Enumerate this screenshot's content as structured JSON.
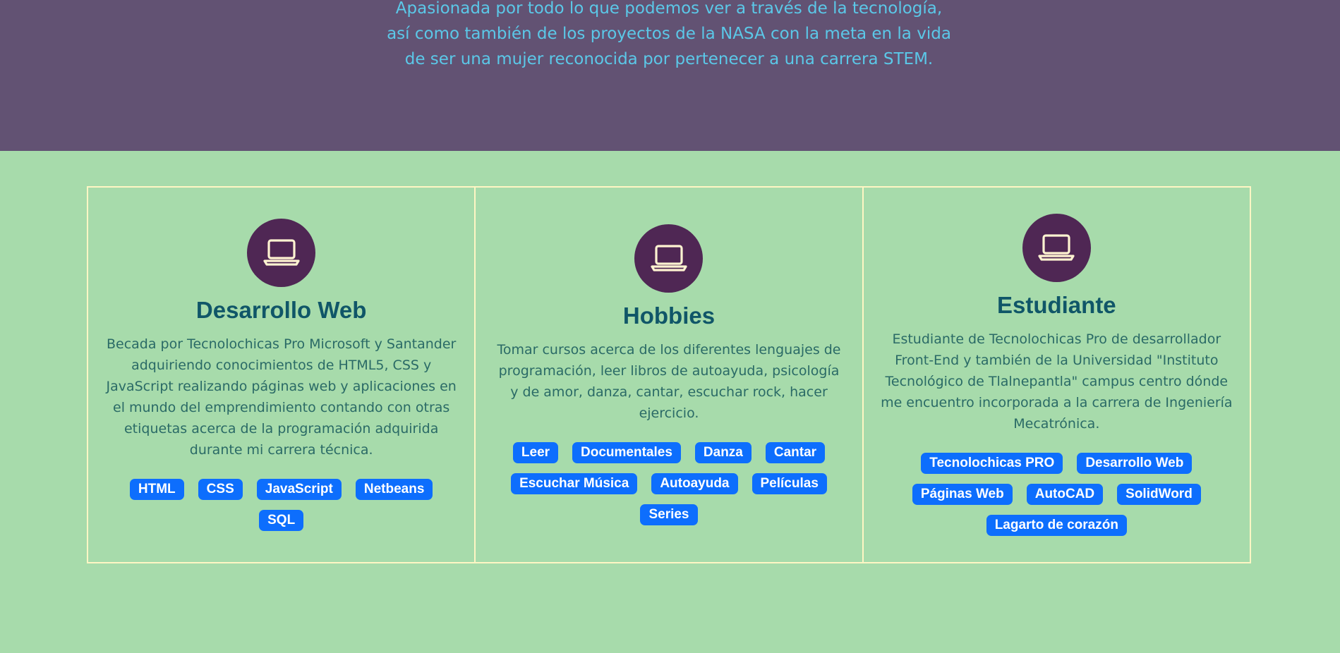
{
  "hero": {
    "text": "Apasionada por todo lo que podemos ver a través de la tecnología, así como también de los proyectos de la NASA con la meta en la vida de ser una mujer reconocida por pertenecer a una carrera STEM."
  },
  "cards": [
    {
      "icon": "laptop-icon",
      "title": "Desarrollo Web",
      "description": "Becada por Tecnolochicas Pro Microsoft y Santander adquiriendo conocimientos de HTML5, CSS y JavaScript realizando páginas web y aplicaciones en el mundo del emprendimiento contando con otras etiquetas acerca de la programación adquirida durante mi carrera técnica.",
      "badges": [
        "HTML",
        "CSS",
        "JavaScript",
        "Netbeans",
        "SQL"
      ]
    },
    {
      "icon": "laptop-icon",
      "title": "Hobbies",
      "description": "Tomar cursos acerca de los diferentes lenguajes de programación, leer libros de autoayuda, psicología y de amor, danza, cantar, escuchar rock, hacer ejercicio.",
      "badges": [
        "Leer",
        "Documentales",
        "Danza",
        "Cantar",
        "Escuchar Música",
        "Autoayuda",
        "Películas",
        "Series"
      ]
    },
    {
      "icon": "laptop-icon",
      "title": "Estudiante",
      "description": "Estudiante de Tecnolochicas Pro de desarrollador Front-End y también de la Universidad \"Instituto Tecnológico de Tlalnepantla\" campus centro dónde me encuentro incorporada a la carrera de Ingeniería Mecatrónica.",
      "badges": [
        "Tecnolochicas PRO",
        "Desarrollo Web",
        "Páginas Web",
        "AutoCAD",
        "SolidWord",
        "Lagarto de corazón"
      ]
    }
  ],
  "colors": {
    "hero_bg": "#625273",
    "hero_text": "#5bc8e8",
    "main_bg": "#a7dbab",
    "card_border": "#fff6c4",
    "icon_circle": "#4f2754",
    "title": "#105668",
    "badge_bg": "#0d6efd"
  }
}
